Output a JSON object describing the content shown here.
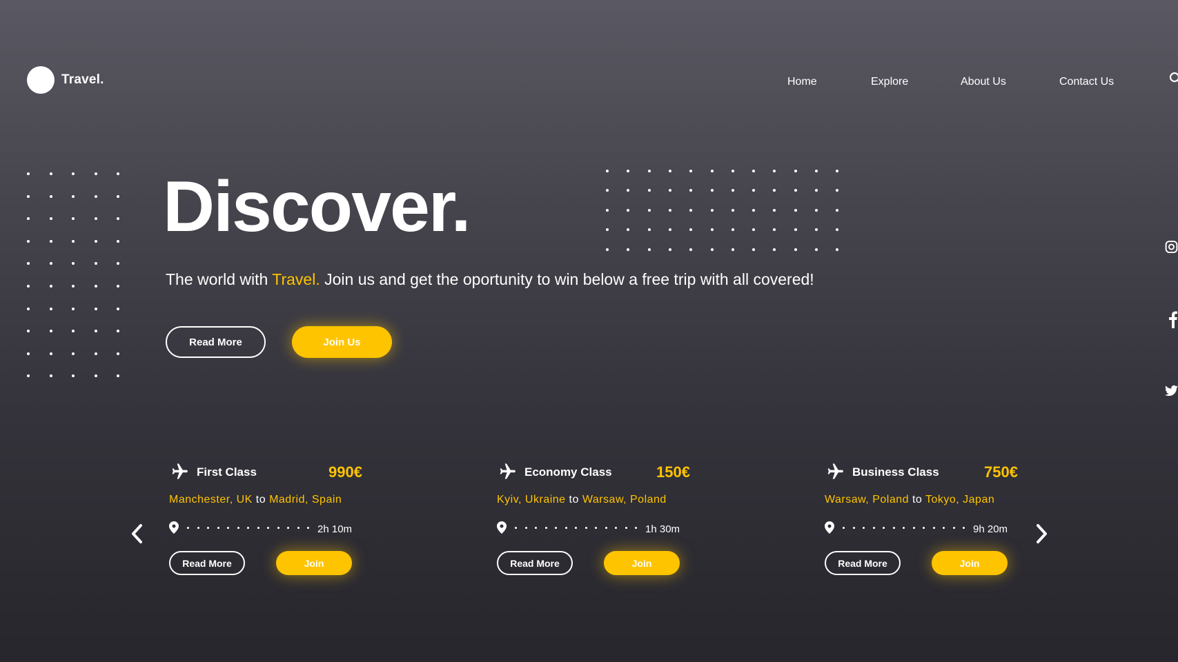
{
  "brand": {
    "name": "Travel."
  },
  "nav": {
    "items": [
      "Home",
      "Explore",
      "About Us",
      "Contact Us"
    ]
  },
  "hero": {
    "title": "Discover.",
    "subtitle_start": "The world with ",
    "subtitle_brand": "Travel.",
    "subtitle_end": " Join us and get the oportunity to win below a free trip with all covered!",
    "read_more_label": "Read More",
    "join_label": "Join Us"
  },
  "colors": {
    "accent": "#ffc400",
    "text": "#ffffff",
    "bg_top": "#5a5862",
    "bg_bottom": "#27262c"
  },
  "social": [
    "instagram-icon",
    "facebook-icon",
    "twitter-icon"
  ],
  "cards": [
    {
      "class": "First Class",
      "price": "990€",
      "from": "Manchester, UK",
      "to_word": "to",
      "to": "Madrid, Spain",
      "duration": "2h 10m",
      "read_more": "Read More",
      "join": "Join"
    },
    {
      "class": "Economy Class",
      "price": "150€",
      "from": "Kyiv, Ukraine",
      "to_word": "to",
      "to": "Warsaw, Poland",
      "duration": "1h 30m",
      "read_more": "Read More",
      "join": "Join"
    },
    {
      "class": "Business Class",
      "price": "750€",
      "from": "Warsaw, Poland",
      "to_word": "to",
      "to": "Tokyo, Japan",
      "duration": "9h 20m",
      "read_more": "Read More",
      "join": "Join"
    }
  ]
}
